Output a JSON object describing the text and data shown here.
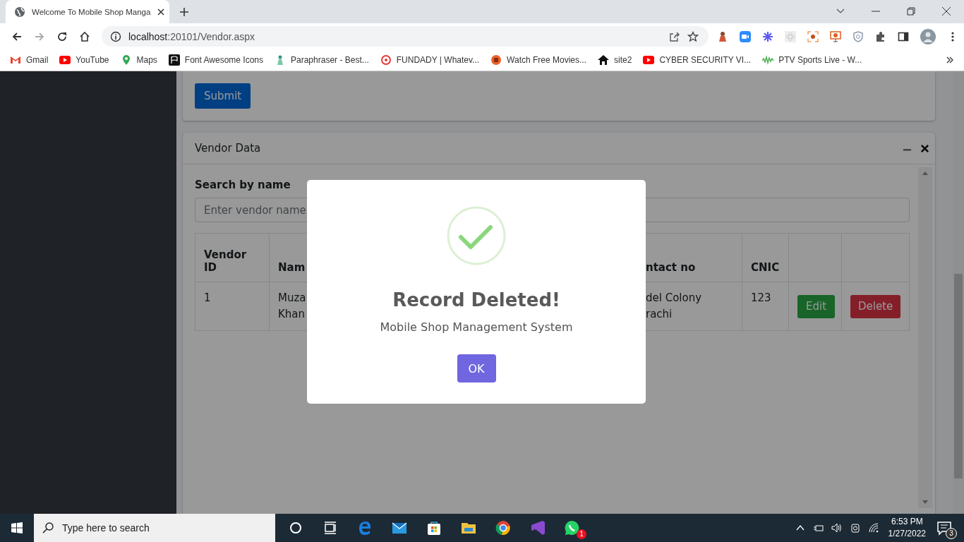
{
  "browser": {
    "tab_title": "Welcome To Mobile Shop Manga",
    "address_host": "localhost",
    "address_path": ":20101/Vendor.aspx",
    "bookmarks": [
      {
        "label": "Gmail"
      },
      {
        "label": "YouTube"
      },
      {
        "label": "Maps"
      },
      {
        "label": "Font Awesome Icons"
      },
      {
        "label": "Paraphraser - Best..."
      },
      {
        "label": "FUNDADY | Whatev..."
      },
      {
        "label": "Watch Free Movies..."
      },
      {
        "label": "site2"
      },
      {
        "label": "CYBER SECURITY VI..."
      },
      {
        "label": "PTV Sports Live - W..."
      }
    ]
  },
  "page": {
    "submit_button": "Submit",
    "panel": {
      "title": "Vendor Data",
      "search_label": "Search by name",
      "search_placeholder": "Enter vendor name",
      "columns": [
        "Vendor ID",
        "Nam",
        "ntact no",
        "CNIC"
      ],
      "rows": [
        {
          "id": "1",
          "name": [
            "Muza",
            "Khan"
          ],
          "contact": [
            "del Colony",
            "rachi"
          ],
          "cnic": "123",
          "edit": "Edit",
          "delete": "Delete"
        }
      ]
    }
  },
  "dialog": {
    "title": "Record Deleted!",
    "text": "Mobile Shop Management System",
    "button": "OK"
  },
  "taskbar": {
    "search_placeholder": "Type here to search",
    "chat_badge": "1",
    "time": "6:53 PM",
    "date": "1/27/2022",
    "notification_count": "3"
  }
}
